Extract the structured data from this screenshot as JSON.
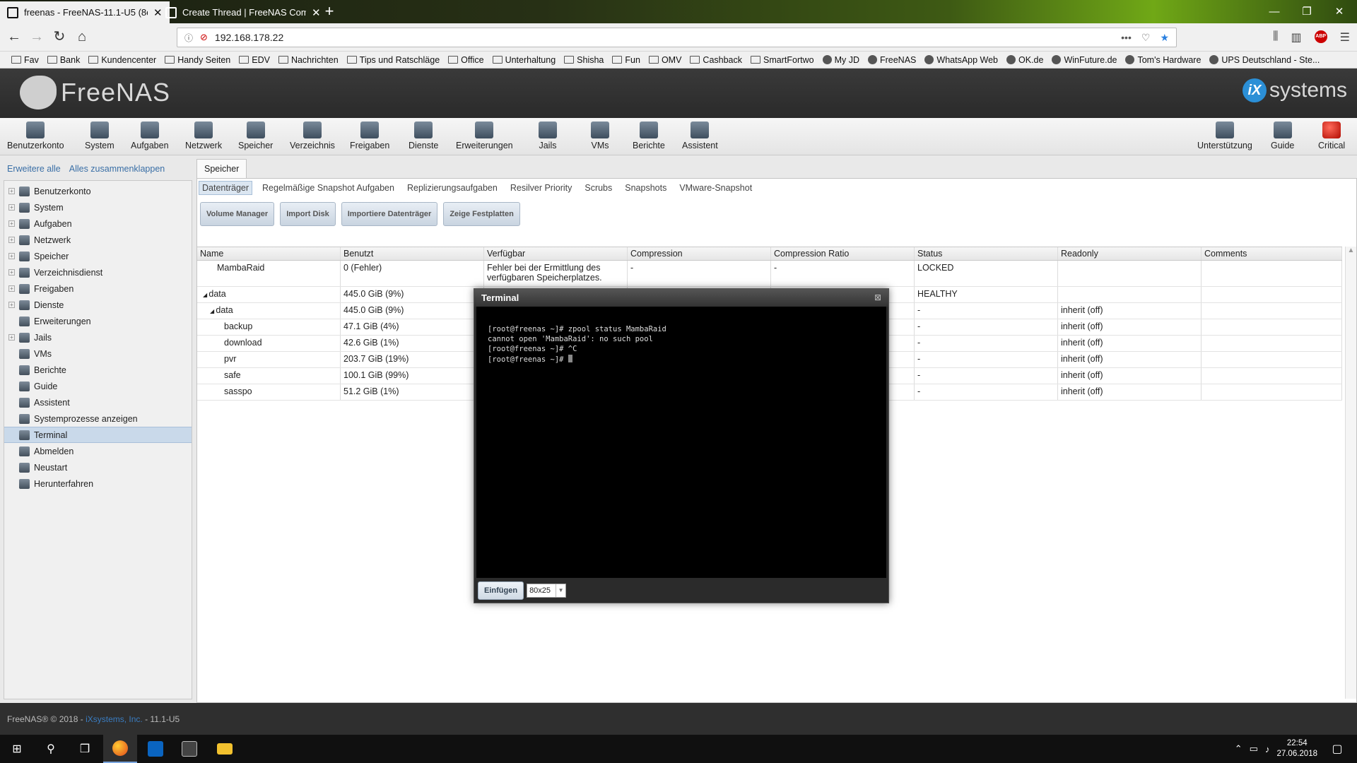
{
  "browser": {
    "tabs": [
      {
        "title": "freenas - FreeNAS-11.1-U5 (8e…",
        "active": true
      },
      {
        "title": "Create Thread | FreeNAS Comm…",
        "active": false
      }
    ],
    "url": "192.168.178.22",
    "bookmarks": [
      {
        "label": "Fav",
        "type": "folder"
      },
      {
        "label": "Bank",
        "type": "folder"
      },
      {
        "label": "Kundencenter",
        "type": "folder"
      },
      {
        "label": "Handy Seiten",
        "type": "folder"
      },
      {
        "label": "EDV",
        "type": "folder"
      },
      {
        "label": "Nachrichten",
        "type": "folder"
      },
      {
        "label": "Tips und Ratschläge",
        "type": "folder"
      },
      {
        "label": "Office",
        "type": "folder"
      },
      {
        "label": "Unterhaltung",
        "type": "folder"
      },
      {
        "label": "Shisha",
        "type": "folder"
      },
      {
        "label": "Fun",
        "type": "folder"
      },
      {
        "label": "OMV",
        "type": "folder"
      },
      {
        "label": "Cashback",
        "type": "folder"
      },
      {
        "label": "SmartFortwo",
        "type": "folder"
      },
      {
        "label": "My JD",
        "type": "site"
      },
      {
        "label": "FreeNAS",
        "type": "site"
      },
      {
        "label": "WhatsApp Web",
        "type": "site"
      },
      {
        "label": "OK.de",
        "type": "site"
      },
      {
        "label": "WinFuture.de",
        "type": "site"
      },
      {
        "label": "Tom's Hardware",
        "type": "site"
      },
      {
        "label": "UPS Deutschland - Ste...",
        "type": "site"
      }
    ]
  },
  "header": {
    "logo_text": "FreeNAS",
    "brand_ix": "iX",
    "brand_text": "systems"
  },
  "toolbar": {
    "left": [
      "Benutzerkonto",
      "System",
      "Aufgaben",
      "Netzwerk",
      "Speicher",
      "Verzeichnis",
      "Freigaben",
      "Dienste",
      "Erweiterungen",
      "Jails",
      "VMs",
      "Berichte",
      "Assistent"
    ],
    "right": [
      "Unterstützung",
      "Guide",
      "Critical"
    ]
  },
  "sidebar": {
    "expand_all": "Erweitere alle",
    "collapse_all": "Alles zusammenklappen",
    "items": [
      {
        "label": "Benutzerkonto",
        "expandable": true
      },
      {
        "label": "System",
        "expandable": true
      },
      {
        "label": "Aufgaben",
        "expandable": true
      },
      {
        "label": "Netzwerk",
        "expandable": true
      },
      {
        "label": "Speicher",
        "expandable": true
      },
      {
        "label": "Verzeichnisdienst",
        "expandable": true
      },
      {
        "label": "Freigaben",
        "expandable": true
      },
      {
        "label": "Dienste",
        "expandable": true
      },
      {
        "label": "Erweiterungen",
        "expandable": false
      },
      {
        "label": "Jails",
        "expandable": true
      },
      {
        "label": "VMs",
        "expandable": false
      },
      {
        "label": "Berichte",
        "expandable": false
      },
      {
        "label": "Guide",
        "expandable": false
      },
      {
        "label": "Assistent",
        "expandable": false
      },
      {
        "label": "Systemprozesse anzeigen",
        "expandable": false
      },
      {
        "label": "Terminal",
        "expandable": false,
        "selected": true
      },
      {
        "label": "Abmelden",
        "expandable": false
      },
      {
        "label": "Neustart",
        "expandable": false
      },
      {
        "label": "Herunterfahren",
        "expandable": false
      }
    ]
  },
  "panel": {
    "tab": "Speicher",
    "subtabs": [
      "Datenträger",
      "Regelmäßige Snapshot Aufgaben",
      "Replizierungsaufgaben",
      "Resilver Priority",
      "Scrubs",
      "Snapshots",
      "VMware-Snapshot"
    ],
    "active_subtab": 0,
    "buttons": [
      "Volume Manager",
      "Import Disk",
      "Importiere Datenträger",
      "Zeige Festplatten"
    ],
    "columns": [
      "Name",
      "Benutzt",
      "Verfügbar",
      "Compression",
      "Compression Ratio",
      "Status",
      "Readonly",
      "Comments"
    ],
    "rows": [
      {
        "indent": 1,
        "expander": "",
        "name": "MambaRaid",
        "used": "0 (Fehler)",
        "avail": "Fehler bei der Ermittlung des",
        "avail2": "verfügbaren Speicherplatzes.",
        "comp": "-",
        "ratio": "-",
        "status": "LOCKED",
        "readonly": "",
        "comments": ""
      },
      {
        "indent": 0,
        "expander": "◢",
        "name": "data",
        "used": "445.0 GiB (9%)",
        "avail": "",
        "avail2": "",
        "comp": "",
        "ratio": "",
        "status": "HEALTHY",
        "readonly": "",
        "comments": ""
      },
      {
        "indent": 1,
        "expander": "◢",
        "name": "data",
        "used": "445.0 GiB (9%)",
        "avail": "",
        "avail2": "",
        "comp": "",
        "ratio": "",
        "status": "-",
        "readonly": "inherit (off)",
        "comments": ""
      },
      {
        "indent": 2,
        "expander": "",
        "name": "backup",
        "used": "47.1 GiB (4%)",
        "avail": "",
        "avail2": "",
        "comp": "",
        "ratio": "",
        "status": "-",
        "readonly": "inherit (off)",
        "comments": ""
      },
      {
        "indent": 2,
        "expander": "",
        "name": "download",
        "used": "42.6 GiB (1%)",
        "avail": "",
        "avail2": "",
        "comp": "",
        "ratio": "",
        "status": "-",
        "readonly": "inherit (off)",
        "comments": ""
      },
      {
        "indent": 2,
        "expander": "",
        "name": "pvr",
        "used": "203.7 GiB (19%)",
        "avail": "",
        "avail2": "",
        "comp": "",
        "ratio": "",
        "status": "-",
        "readonly": "inherit (off)",
        "comments": ""
      },
      {
        "indent": 2,
        "expander": "",
        "name": "safe",
        "used": "100.1 GiB (99%)",
        "avail": "",
        "avail2": "",
        "comp": "",
        "ratio": "",
        "status": "-",
        "readonly": "inherit (off)",
        "comments": ""
      },
      {
        "indent": 2,
        "expander": "",
        "name": "sasspo",
        "used": "51.2 GiB (1%)",
        "avail": "",
        "avail2": "",
        "comp": "",
        "ratio": "",
        "status": "-",
        "readonly": "inherit (off)",
        "comments": ""
      }
    ]
  },
  "terminal": {
    "title": "Terminal",
    "close": "⊠",
    "lines": [
      "[root@freenas ~]# zpool status MambaRaid",
      "cannot open 'MambaRaid': no such pool",
      "[root@freenas ~]# ^C",
      "[root@freenas ~]# "
    ],
    "paste_label": "Einfügen",
    "size_value": "80x25"
  },
  "footer": {
    "copyright": "FreeNAS® © 2018 - ",
    "company": "iXsystems, Inc.",
    "version": " - 11.1-U5"
  },
  "taskbar": {
    "time": "22:54",
    "date": "27.06.2018"
  },
  "colors": {
    "accent": "#2b8fd6",
    "selected": "#c9d9ea",
    "critical": "#c00000"
  }
}
